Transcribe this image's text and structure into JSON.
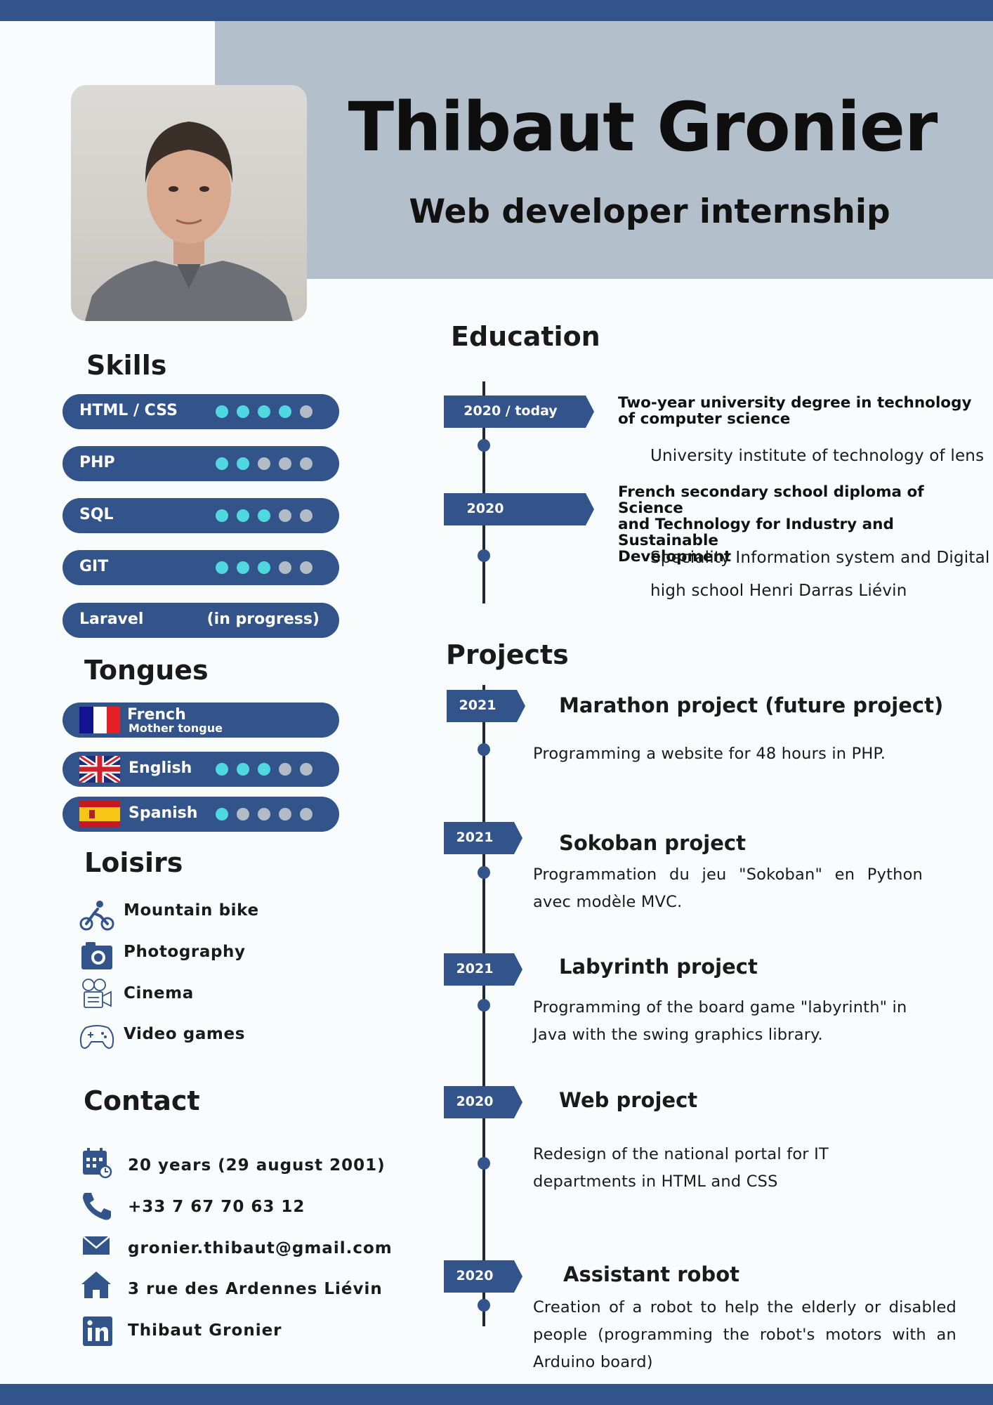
{
  "header": {
    "name": "Thibaut Gronier",
    "subtitle": "Web developer internship"
  },
  "colors": {
    "primary": "#33548a",
    "header_background": "#b3c0cc",
    "dot_active": "#4fd8e0",
    "dot_inactive": "#b2bcc6",
    "page_background": "#f8fcfc"
  },
  "skills": {
    "title": "Skills",
    "items": [
      {
        "label": "HTML / CSS",
        "level": 4,
        "max": 5
      },
      {
        "label": "PHP",
        "level": 2,
        "max": 5
      },
      {
        "label": "SQL",
        "level": 3,
        "max": 5
      },
      {
        "label": "GIT",
        "level": 3,
        "max": 5
      },
      {
        "label": "Laravel",
        "note": "(in progress)"
      }
    ]
  },
  "tongues": {
    "title": "Tongues",
    "items": [
      {
        "name": "French",
        "note": "Mother tongue",
        "flag": "france-flag-icon"
      },
      {
        "name": "English",
        "level": 3,
        "max": 5,
        "flag": "uk-flag-icon"
      },
      {
        "name": "Spanish",
        "level": 1,
        "max": 5,
        "flag": "spain-flag-icon"
      }
    ]
  },
  "hobbies": {
    "title": "Loisirs",
    "items": [
      {
        "label": "Mountain bike",
        "icon": "mountain-bike-icon"
      },
      {
        "label": "Photography",
        "icon": "camera-icon"
      },
      {
        "label": "Cinema",
        "icon": "cinema-projector-icon"
      },
      {
        "label": "Video games",
        "icon": "gamepad-icon"
      }
    ]
  },
  "contact": {
    "title": "Contact",
    "items": [
      {
        "text": "20 years (29 august 2001)",
        "icon": "calendar-icon"
      },
      {
        "text": "+33 7  67 70 63 12",
        "icon": "phone-icon"
      },
      {
        "text": "gronier.thibaut@gmail.com",
        "icon": "envelope-icon"
      },
      {
        "text": "3 rue des Ardennes Liévin",
        "icon": "home-icon"
      },
      {
        "text": "Thibaut Gronier",
        "icon": "linkedin-icon"
      }
    ]
  },
  "education": {
    "title": "Education",
    "items": [
      {
        "date": "2020 / today",
        "title_line1": "Two-year university degree in technology",
        "title_line2": "of computer science",
        "subtitle": "University institute of technology of lens"
      },
      {
        "date": "2020",
        "title_line1": "French secondary school diploma of Science",
        "title_line2": "and Technology for Industry and Sustainable",
        "title_line3": "Development",
        "subtitle": "Speciality Information system and Digital",
        "subtitle2": "high school Henri Darras Liévin"
      }
    ]
  },
  "projects": {
    "title": "Projects",
    "items": [
      {
        "date": "2021",
        "title": "Marathon project (future project)",
        "description": "Programming a website for 48 hours in PHP."
      },
      {
        "date": "2021",
        "title": "Sokoban project",
        "description": "Programmation du jeu \"Sokoban\" en Python avec modèle MVC."
      },
      {
        "date": "2021",
        "title": "Labyrinth project",
        "description": "Programming of the board game \"labyrinth\" in Java with the swing graphics library."
      },
      {
        "date": "2020",
        "title": "Web project",
        "description": "Redesign of the national portal for IT departments in HTML and CSS"
      },
      {
        "date": "2020",
        "title": "Assistant robot",
        "description": "Creation of a robot to help the elderly or disabled people (programming the robot's motors with an Arduino board)"
      }
    ]
  }
}
